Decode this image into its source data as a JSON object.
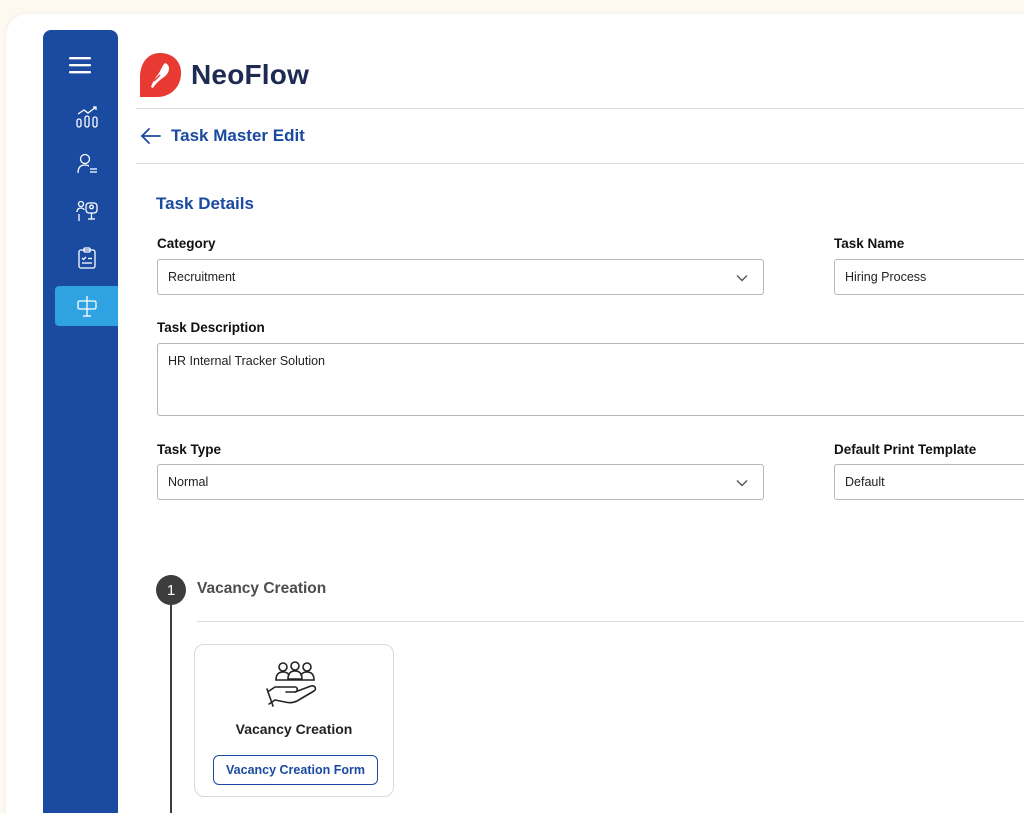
{
  "brand": {
    "name": "NeoFlow",
    "accent": "#1b4aa1",
    "logo_color": "#e83a32"
  },
  "sidebar": {
    "color": "#1b4aa1",
    "active_color": "#2fa3e2",
    "items": [
      {
        "icon": "menu-icon"
      },
      {
        "icon": "analytics-icon"
      },
      {
        "icon": "user-list-icon"
      },
      {
        "icon": "user-monitor-icon"
      },
      {
        "icon": "clipboard-icon"
      },
      {
        "icon": "signpost-icon",
        "active": true
      }
    ]
  },
  "header": {
    "back_icon": "arrow-left-icon",
    "title": "Task Master Edit"
  },
  "task_details": {
    "heading": "Task Details",
    "category": {
      "label": "Category",
      "value": "Recruitment"
    },
    "task_name": {
      "label": "Task Name",
      "value": "Hiring Process"
    },
    "task_description": {
      "label": "Task Description",
      "value": "HR Internal Tracker Solution"
    },
    "task_type": {
      "label": "Task Type",
      "value": "Normal"
    },
    "default_print_template": {
      "label": "Default Print Template",
      "value": "Default"
    }
  },
  "steps": [
    {
      "number": "1",
      "title": "Vacancy Creation",
      "card": {
        "icon": "hand-group-icon",
        "title": "Vacancy Creation",
        "button_label": "Vacancy Creation Form"
      }
    }
  ]
}
